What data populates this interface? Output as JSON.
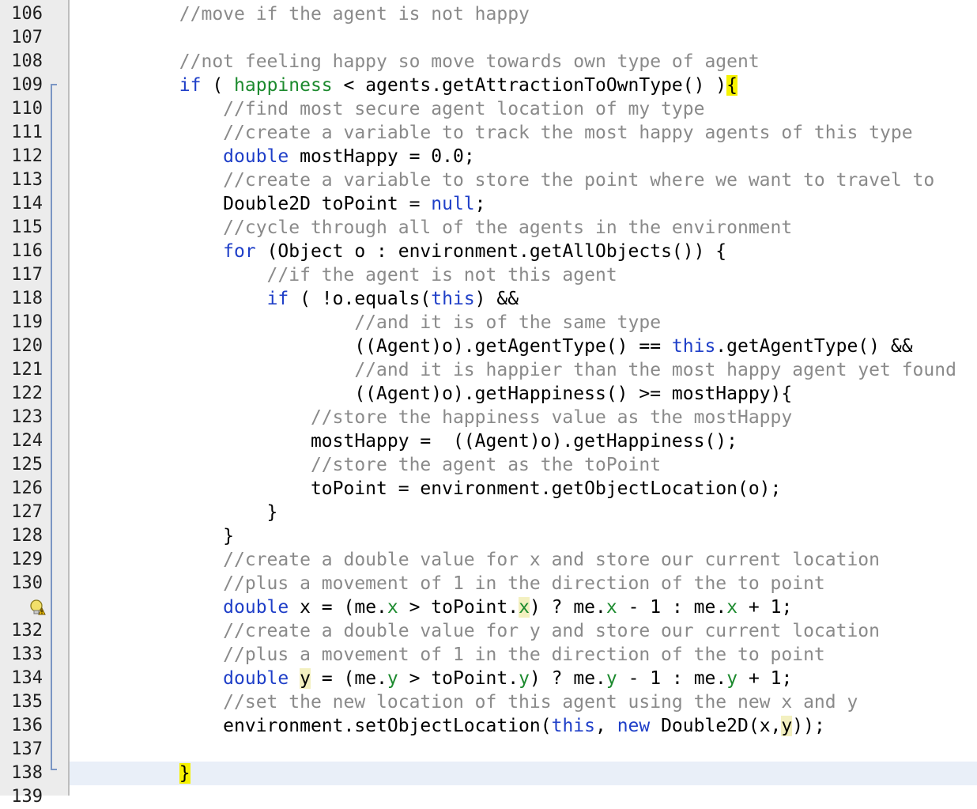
{
  "editor": {
    "lines": [
      {
        "n": "106",
        "tokens": [
          {
            "t": "        //move if the agent is not happy",
            "c": "cmt"
          }
        ]
      },
      {
        "n": "107",
        "tokens": []
      },
      {
        "n": "108",
        "tokens": [
          {
            "t": "        //not feeling happy so move towards own type of agent",
            "c": "cmt"
          }
        ]
      },
      {
        "n": "109",
        "tokens": [
          {
            "t": "        "
          },
          {
            "t": "if",
            "c": "kw"
          },
          {
            "t": " ( "
          },
          {
            "t": "happiness",
            "c": "fld"
          },
          {
            "t": " < agents.getAttractionToOwnType() )"
          },
          {
            "t": "{",
            "c": "hl"
          }
        ]
      },
      {
        "n": "110",
        "tokens": [
          {
            "t": "            //find most secure agent location of my type",
            "c": "cmt"
          }
        ]
      },
      {
        "n": "111",
        "tokens": [
          {
            "t": "            //create a variable to track the most happy agents of this type",
            "c": "cmt"
          }
        ]
      },
      {
        "n": "112",
        "tokens": [
          {
            "t": "            "
          },
          {
            "t": "double",
            "c": "kw"
          },
          {
            "t": " mostHappy = 0.0;"
          }
        ]
      },
      {
        "n": "113",
        "tokens": [
          {
            "t": "            //create a variable to store the point where we want to travel to",
            "c": "cmt"
          }
        ]
      },
      {
        "n": "114",
        "tokens": [
          {
            "t": "            Double2D toPoint = "
          },
          {
            "t": "null",
            "c": "kw"
          },
          {
            "t": ";"
          }
        ]
      },
      {
        "n": "115",
        "tokens": [
          {
            "t": "            //cycle through all of the agents in the environment",
            "c": "cmt"
          }
        ]
      },
      {
        "n": "116",
        "tokens": [
          {
            "t": "            "
          },
          {
            "t": "for",
            "c": "kw"
          },
          {
            "t": " (Object o : environment.getAllObjects()) {"
          }
        ]
      },
      {
        "n": "117",
        "tokens": [
          {
            "t": "                //if the agent is not this agent",
            "c": "cmt"
          }
        ]
      },
      {
        "n": "118",
        "tokens": [
          {
            "t": "                "
          },
          {
            "t": "if",
            "c": "kw"
          },
          {
            "t": " ( !o.equals("
          },
          {
            "t": "this",
            "c": "kw"
          },
          {
            "t": ") &&"
          }
        ]
      },
      {
        "n": "119",
        "tokens": [
          {
            "t": "                        //and it is of the same type",
            "c": "cmt"
          }
        ]
      },
      {
        "n": "120",
        "tokens": [
          {
            "t": "                        ((Agent)o).getAgentType() == "
          },
          {
            "t": "this",
            "c": "kw"
          },
          {
            "t": ".getAgentType() &&"
          }
        ]
      },
      {
        "n": "121",
        "tokens": [
          {
            "t": "                        //and it is happier than the most happy agent yet found",
            "c": "cmt"
          }
        ]
      },
      {
        "n": "122",
        "tokens": [
          {
            "t": "                        ((Agent)o).getHappiness() >= mostHappy){"
          }
        ]
      },
      {
        "n": "123",
        "tokens": [
          {
            "t": "                    //store the happiness value as the mostHappy",
            "c": "cmt"
          }
        ]
      },
      {
        "n": "124",
        "tokens": [
          {
            "t": "                    mostHappy =  ((Agent)o).getHappiness();"
          }
        ]
      },
      {
        "n": "125",
        "tokens": [
          {
            "t": "                    //store the agent as the toPoint",
            "c": "cmt"
          }
        ]
      },
      {
        "n": "126",
        "tokens": [
          {
            "t": "                    toPoint = environment.getObjectLocation(o);"
          }
        ]
      },
      {
        "n": "127",
        "tokens": [
          {
            "t": "                }"
          }
        ]
      },
      {
        "n": "128",
        "tokens": [
          {
            "t": "            }"
          }
        ]
      },
      {
        "n": "129",
        "tokens": [
          {
            "t": "            //create a double value for x and store our current location",
            "c": "cmt"
          }
        ]
      },
      {
        "n": "130",
        "tokens": [
          {
            "t": "            //plus a movement of 1 in the direction of the to point",
            "c": "cmt"
          }
        ]
      },
      {
        "n": "",
        "bulb": true,
        "tokens": [
          {
            "t": "            "
          },
          {
            "t": "double",
            "c": "kw"
          },
          {
            "t": " x = (me."
          },
          {
            "t": "x",
            "c": "fld"
          },
          {
            "t": " > toPoint."
          },
          {
            "t": "x",
            "c": "fld mark"
          },
          {
            "t": ") ? me."
          },
          {
            "t": "x",
            "c": "fld"
          },
          {
            "t": " - 1 : me."
          },
          {
            "t": "x",
            "c": "fld"
          },
          {
            "t": " + 1;"
          }
        ]
      },
      {
        "n": "132",
        "tokens": [
          {
            "t": "            //create a double value for y and store our current location",
            "c": "cmt"
          }
        ]
      },
      {
        "n": "133",
        "tokens": [
          {
            "t": "            //plus a movement of 1 in the direction of the to point",
            "c": "cmt"
          }
        ]
      },
      {
        "n": "134",
        "tokens": [
          {
            "t": "            "
          },
          {
            "t": "double",
            "c": "kw"
          },
          {
            "t": " "
          },
          {
            "t": "y",
            "c": "mark"
          },
          {
            "t": " = (me."
          },
          {
            "t": "y",
            "c": "fld"
          },
          {
            "t": " > toPoint."
          },
          {
            "t": "y",
            "c": "fld"
          },
          {
            "t": ") ? me."
          },
          {
            "t": "y",
            "c": "fld"
          },
          {
            "t": " - 1 : me."
          },
          {
            "t": "y",
            "c": "fld"
          },
          {
            "t": " + 1;"
          }
        ]
      },
      {
        "n": "135",
        "tokens": [
          {
            "t": "            //set the new location of this agent using the new x and y",
            "c": "cmt"
          }
        ]
      },
      {
        "n": "136",
        "tokens": [
          {
            "t": "            environment.setObjectLocation("
          },
          {
            "t": "this",
            "c": "kw"
          },
          {
            "t": ", "
          },
          {
            "t": "new",
            "c": "kw"
          },
          {
            "t": " Double2D(x,"
          },
          {
            "t": "y",
            "c": "mark"
          },
          {
            "t": "));"
          }
        ]
      },
      {
        "n": "137",
        "tokens": []
      },
      {
        "n": "138",
        "current": true,
        "tokens": [
          {
            "t": "        "
          },
          {
            "t": "}",
            "c": "hl"
          }
        ]
      },
      {
        "n": "139",
        "tokens": []
      }
    ]
  }
}
